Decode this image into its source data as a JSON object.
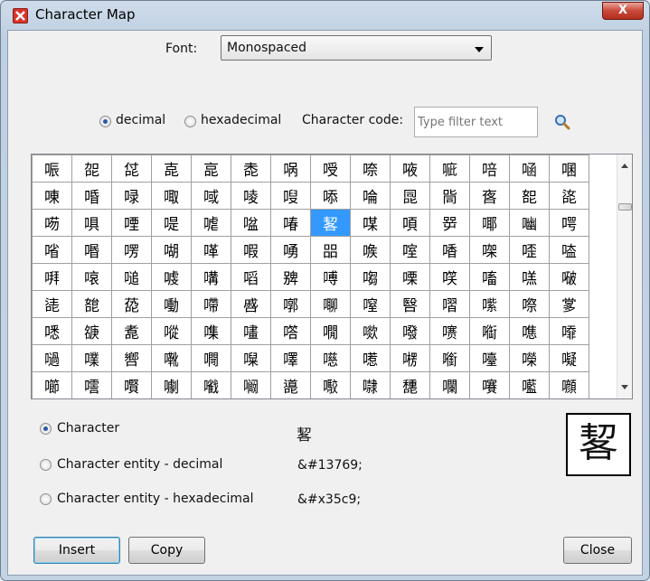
{
  "window": {
    "title": "Character Map",
    "close_glyph": "X"
  },
  "font": {
    "label": "Font:",
    "selected": "Monospaced"
  },
  "code_mode": {
    "decimal_label": "decimal",
    "hexadecimal_label": "hexadecimal",
    "selected": "decimal"
  },
  "filter": {
    "label": "Character code:",
    "placeholder": "Type filter text"
  },
  "grid": {
    "rows": [
      [
        "㖘",
        "㖙",
        "㖚",
        "㖛",
        "㖜",
        "㖝",
        "㖞",
        "㖟",
        "㖠",
        "㖡",
        "㖢",
        "㖣",
        "㖤",
        "㖥"
      ],
      [
        "㖦",
        "㖧",
        "㖨",
        "㖩",
        "㖪",
        "㖫",
        "㖬",
        "㖭",
        "㖮",
        "㖯",
        "㖰",
        "㖱",
        "㖲",
        "㖳"
      ],
      [
        "㖴",
        "㖵",
        "㖶",
        "㖷",
        "㖸",
        "㖹",
        "㖺",
        "㗉",
        "㖼",
        "㖽",
        "㖾",
        "㖿",
        "㗀",
        "㗁"
      ],
      [
        "㗂",
        "㗃",
        "㗄",
        "㗅",
        "㗆",
        "㗇",
        "㗈",
        "㗊",
        "㗋",
        "㗌",
        "㗍",
        "㗎",
        "㗏",
        "㗐"
      ],
      [
        "㗑",
        "㗒",
        "㗓",
        "㗔",
        "㗕",
        "㗖",
        "㗗",
        "㗘",
        "㗙",
        "㗚",
        "㗛",
        "㗜",
        "㗝",
        "㗞"
      ],
      [
        "㗟",
        "㗠",
        "㗡",
        "㗢",
        "㗣",
        "㗤",
        "㗥",
        "㗦",
        "㗧",
        "㗨",
        "㗩",
        "㗪",
        "㗫",
        "㗬"
      ],
      [
        "㗭",
        "㗮",
        "㗯",
        "㗰",
        "㗱",
        "㗲",
        "㗳",
        "㗴",
        "㗵",
        "㗶",
        "㗷",
        "㗸",
        "㗹",
        "㗺"
      ],
      [
        "㗻",
        "㗼",
        "㗽",
        "㗾",
        "㗿",
        "㘀",
        "㘁",
        "㘂",
        "㘃",
        "㘄",
        "㘅",
        "㘆",
        "㘇",
        "㘈"
      ],
      [
        "㘉",
        "㘊",
        "㘋",
        "㘌",
        "㘍",
        "㘎",
        "㘏",
        "㘐",
        "㘑",
        "㘒",
        "㘓",
        "㘔",
        "㘕",
        "㘖"
      ]
    ],
    "selected_row": 2,
    "selected_col": 7
  },
  "output": {
    "selected": "character",
    "character_label": "Character",
    "character_value": "㗉",
    "entity_decimal_label": "Character entity - decimal",
    "entity_decimal_value": "&#13769;",
    "entity_hex_label": "Character entity - hexadecimal",
    "entity_hex_value": "&#x35c9;"
  },
  "preview": {
    "glyph": "㗉"
  },
  "buttons": {
    "insert": "Insert",
    "copy": "Copy",
    "close": "Close"
  }
}
